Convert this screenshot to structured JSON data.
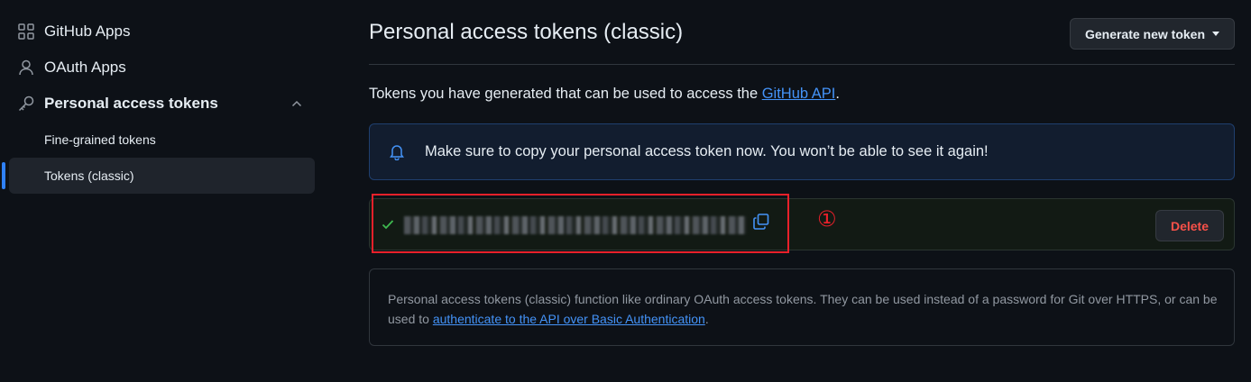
{
  "sidebar": {
    "items": [
      {
        "label": "GitHub Apps",
        "icon": "apps-grid-icon"
      },
      {
        "label": "OAuth Apps",
        "icon": "person-icon"
      },
      {
        "label": "Personal access tokens",
        "icon": "key-icon",
        "expanded": true
      }
    ],
    "sub_items": [
      {
        "label": "Fine-grained tokens",
        "active": false
      },
      {
        "label": "Tokens (classic)",
        "active": true
      }
    ]
  },
  "header": {
    "title": "Personal access tokens (classic)",
    "generate_button": "Generate new token"
  },
  "intro": {
    "prefix": "Tokens you have generated that can be used to access the ",
    "link": "GitHub API",
    "suffix": "."
  },
  "flash": {
    "icon": "bell-icon",
    "message": "Make sure to copy your personal access token now. You won’t be able to see it again!"
  },
  "token": {
    "value_obscured": true,
    "delete_label": "Delete",
    "copy_icon": "copy-icon",
    "status_icon": "check-icon"
  },
  "annotation": {
    "step_marker": "①",
    "highlight_color": "#e8202a"
  },
  "info": {
    "text_prefix": "Personal access tokens (classic) function like ordinary OAuth access tokens. They can be used instead of a password for Git over HTTPS, or can be used to ",
    "link": "authenticate to the API over Basic Authentication",
    "text_suffix": "."
  },
  "colors": {
    "background": "#0d1117",
    "accent": "#2f81f7",
    "link": "#4493f8",
    "danger": "#f85149",
    "success": "#3fb950"
  }
}
